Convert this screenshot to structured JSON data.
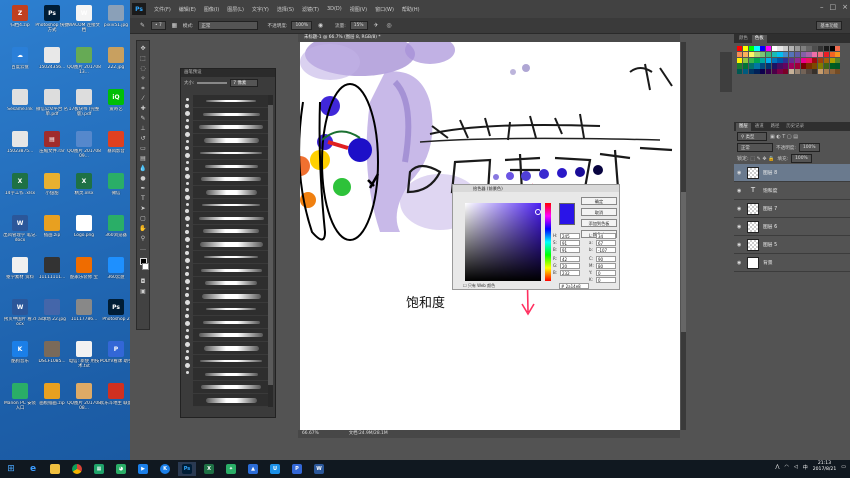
{
  "desktop": {
    "icons": [
      {
        "label": "归档4.zip",
        "color": "#c04020",
        "glyph": "Z"
      },
      {
        "label": "Photoshop 快捷方式",
        "color": "#001d35",
        "glyph": "Ps"
      },
      {
        "label": "WACOM 连接文档",
        "color": "#f4f4f4",
        "glyph": "W"
      },
      {
        "label": "pixiv51.jpg",
        "color": "#8aa0b8",
        "glyph": ""
      },
      {
        "label": "百度云盘",
        "color": "#2a7fd8",
        "glyph": "☁"
      },
      {
        "label": "15024356...",
        "color": "#e8e8e8",
        "glyph": ""
      },
      {
        "label": "QQ图片 20170813...",
        "color": "#66aa55",
        "glyph": ""
      },
      {
        "label": "222.jpg",
        "color": "#c8a060",
        "glyph": ""
      },
      {
        "label": "Sesame.lnk",
        "color": "#e0e0e0",
        "glyph": ""
      },
      {
        "label": "微信公众平台 名单.pdf",
        "color": "#dddddd",
        "glyph": ""
      },
      {
        "label": "17板块书 (完整版).pdf",
        "color": "#dddddd",
        "glyph": ""
      },
      {
        "label": "爱奇艺",
        "color": "#00be06",
        "glyph": "iQ"
      },
      {
        "label": "15023875...",
        "color": "#e6e6e6",
        "glyph": ""
      },
      {
        "label": "压缩文件.rar",
        "color": "#a02c2c",
        "glyph": "▤"
      },
      {
        "label": "QQ图片 20170809...",
        "color": "#5588cc",
        "glyph": ""
      },
      {
        "label": "暴风影音",
        "color": "#e04020",
        "glyph": ""
      },
      {
        "label": "14字工作 .xlsx",
        "color": "#1e7145",
        "glyph": "X"
      },
      {
        "label": "小甜甜",
        "color": "#e8b030",
        "glyph": ""
      },
      {
        "label": "精灵.xlsx",
        "color": "#1e7145",
        "glyph": "X"
      },
      {
        "label": "微信",
        "color": "#2aae67",
        "glyph": ""
      },
      {
        "label": "出风管理学 笔记.docx",
        "color": "#2b579a",
        "glyph": "W"
      },
      {
        "label": "插画.zip",
        "color": "#e8a020",
        "glyph": ""
      },
      {
        "label": "Logo.png",
        "color": "#ffffff",
        "glyph": ""
      },
      {
        "label": "360浏览器",
        "color": "#2aae67",
        "glyph": ""
      },
      {
        "label": "抠学素材 资料",
        "color": "#f0f0f0",
        "glyph": ""
      },
      {
        "label": "11111111...",
        "color": "#333333",
        "glyph": ""
      },
      {
        "label": "酷家乐装修 宝",
        "color": "#ef6c00",
        "glyph": ""
      },
      {
        "label": "360云盘",
        "color": "#1e90ff",
        "glyph": ""
      },
      {
        "label": "拷贝中国片 看.docx",
        "color": "#2b579a",
        "glyph": "W"
      },
      {
        "label": "ai球场 22.jpg",
        "color": "#4466aa",
        "glyph": ""
      },
      {
        "label": "11117786...",
        "color": "#888888",
        "glyph": ""
      },
      {
        "label": "Photoshop 2",
        "color": "#001d35",
        "glyph": "Ps"
      },
      {
        "label": "酷狗音乐",
        "color": "#1b7fe8",
        "glyph": "K"
      },
      {
        "label": "DSCF1085...",
        "color": "#7a6a5a",
        "glyph": ""
      },
      {
        "label": "电信: 新使 用技术.txt",
        "color": "#f2f2f2",
        "glyph": ""
      },
      {
        "label": "POLYV看课 助手",
        "color": "#3367d6",
        "glyph": "P"
      },
      {
        "label": "Manon PC 安装入口",
        "color": "#2aae67",
        "glyph": ""
      },
      {
        "label": "画板插画.zip",
        "color": "#e8a020",
        "glyph": ""
      },
      {
        "label": "QQ图片 20170808...",
        "color": "#ddaa66",
        "glyph": ""
      },
      {
        "label": "欢乐斗地主 联盟",
        "color": "#d03020",
        "glyph": ""
      }
    ]
  },
  "ps": {
    "menu": [
      "文件(F)",
      "编辑(E)",
      "图像(I)",
      "图层(L)",
      "文字(Y)",
      "选择(S)",
      "滤镜(T)",
      "3D(D)",
      "视图(V)",
      "窗口(W)",
      "帮助(H)"
    ],
    "options": {
      "mode_label": "模式:",
      "mode_value": "正常",
      "opacity_label": "不透明度:",
      "opacity_value": "100%",
      "flow_label": "流量:",
      "flow_value": "15%",
      "workspace": "基本功能"
    },
    "brush_panel": {
      "title": "画笔预设",
      "size_label": "大小:",
      "size_value": "7 像素"
    },
    "doc_tab": "未标题-1 @ 66.7% (图层 8, RGB/8) *",
    "status_zoom": "66.67%",
    "status_doc": "文档:24.9M/28.1M",
    "canvas_text": "饱和度",
    "picker": {
      "title": "拾色器 (前景色)",
      "btn_ok": "确定",
      "btn_cancel": "取消",
      "btn_add": "添加到色板",
      "btn_lib": "颜色库",
      "web_only": "只有 Web 颜色",
      "hex": "2a14e8",
      "fields": [
        {
          "label": "H:",
          "value": "245"
        },
        {
          "label": "S:",
          "value": "91"
        },
        {
          "label": "B:",
          "value": "91"
        },
        {
          "label": "R:",
          "value": "42"
        },
        {
          "label": "G:",
          "value": "20"
        },
        {
          "label": "B:",
          "value": "232"
        },
        {
          "label": "L:",
          "value": "34"
        },
        {
          "label": "a:",
          "value": "67"
        },
        {
          "label": "b:",
          "value": "-107"
        },
        {
          "label": "C:",
          "value": "90"
        },
        {
          "label": "M:",
          "value": "80"
        },
        {
          "label": "Y:",
          "value": "0"
        },
        {
          "label": "K:",
          "value": "0"
        }
      ]
    },
    "swatch_tabs": [
      "颜色",
      "色板"
    ],
    "layer_tabs": [
      "图层",
      "通道",
      "路径",
      "历史记录"
    ],
    "layer_opts": {
      "blend": "正常",
      "opacity_label": "不透明度:",
      "opacity": "100%",
      "fill_label": "填充:",
      "fill": "100%"
    },
    "layers": [
      {
        "name": "图层 8",
        "type": "checker",
        "active": true
      },
      {
        "name": "饱和度",
        "type": "text",
        "active": false
      },
      {
        "name": "图层 7",
        "type": "checker",
        "active": false
      },
      {
        "name": "图层 6",
        "type": "checker",
        "active": false
      },
      {
        "name": "图层 5",
        "type": "checker",
        "active": false
      },
      {
        "name": "背景",
        "type": "white",
        "active": false
      }
    ],
    "swatch_colors": [
      "#ff0000",
      "#ffff00",
      "#00ff00",
      "#00ffff",
      "#0000ff",
      "#ff00ff",
      "#ffffff",
      "#e6e6e6",
      "#cccccc",
      "#b3b3b3",
      "#999999",
      "#808080",
      "#666666",
      "#4d4d4d",
      "#333333",
      "#1a1a1a",
      "#000000",
      "#f26c4f",
      "#f68e55",
      "#fbaf5c",
      "#fff467",
      "#acd372",
      "#7cc576",
      "#3bb878",
      "#1abbb4",
      "#00bff3",
      "#438ccb",
      "#5574b9",
      "#605ca8",
      "#855fa8",
      "#a763a9",
      "#f06ea9",
      "#f26d7d",
      "#ed1c24",
      "#f26522",
      "#f7941d",
      "#fff200",
      "#8dc63f",
      "#39b54a",
      "#00a651",
      "#00a99d",
      "#00aeef",
      "#0072bc",
      "#0054a6",
      "#2e3192",
      "#662d91",
      "#92278f",
      "#ec008c",
      "#ed145b",
      "#9e0b0f",
      "#a0410d",
      "#a36209",
      "#aba000",
      "#598527",
      "#1a7b30",
      "#007236",
      "#00746b",
      "#0076a3",
      "#004b80",
      "#003471",
      "#1b1464",
      "#440e62",
      "#630460",
      "#9e005d",
      "#9e0039",
      "#790000",
      "#7b2e00",
      "#7d4900",
      "#827b00",
      "#406618",
      "#005e20",
      "#005826",
      "#005952",
      "#005b7f",
      "#003663",
      "#002157",
      "#0d004c",
      "#32004b",
      "#4b0049",
      "#7b0046",
      "#7a0026",
      "#c7b299",
      "#998675",
      "#736357",
      "#534741",
      "#37302a",
      "#c69c6d",
      "#a67c52",
      "#8c6239",
      "#754c24"
    ]
  },
  "taskbar": {
    "time": "21:13",
    "date": "2017/8/21"
  }
}
